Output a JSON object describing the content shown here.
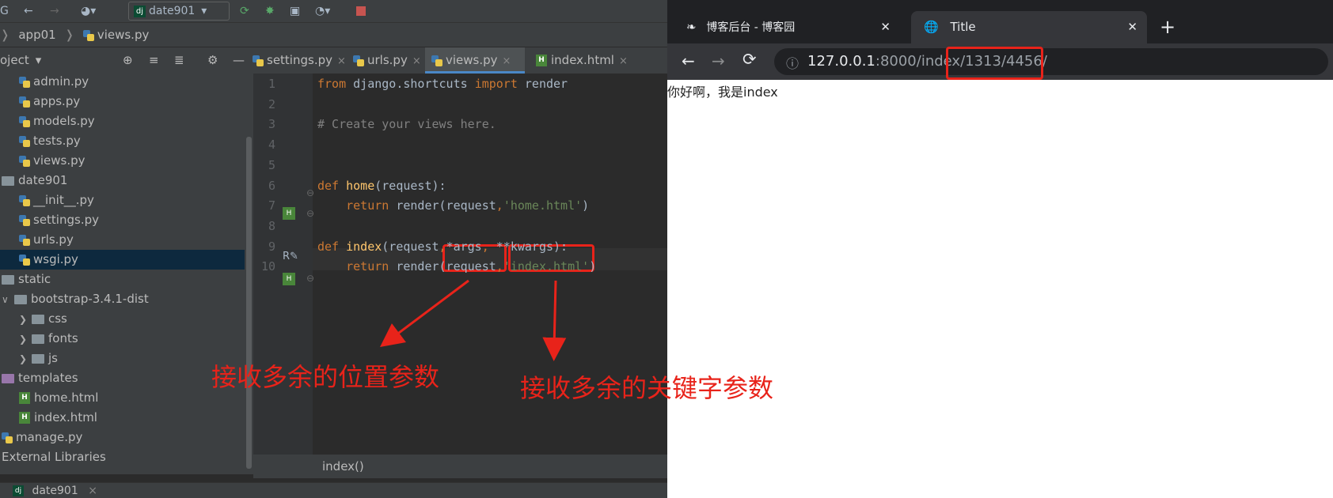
{
  "ide": {
    "toolbar": {
      "config_name": "date901"
    },
    "breadcrumb": [
      "app01",
      "views.py"
    ],
    "project_label": "oject",
    "tree": [
      {
        "label": "admin.py",
        "type": "py",
        "indent": 1
      },
      {
        "label": "apps.py",
        "type": "py",
        "indent": 1
      },
      {
        "label": "models.py",
        "type": "py",
        "indent": 1
      },
      {
        "label": "tests.py",
        "type": "py",
        "indent": 1
      },
      {
        "label": "views.py",
        "type": "py",
        "indent": 1
      },
      {
        "label": "date901",
        "type": "folder",
        "indent": 0
      },
      {
        "label": "__init__.py",
        "type": "py",
        "indent": 1
      },
      {
        "label": "settings.py",
        "type": "py",
        "indent": 1
      },
      {
        "label": "urls.py",
        "type": "py",
        "indent": 1
      },
      {
        "label": "wsgi.py",
        "type": "py",
        "indent": 1
      },
      {
        "label": "static",
        "type": "folder",
        "indent": 0
      },
      {
        "label": "bootstrap-3.4.1-dist",
        "type": "folder",
        "indent": 1
      },
      {
        "label": "css",
        "type": "folder",
        "indent": 2
      },
      {
        "label": "fonts",
        "type": "folder",
        "indent": 2
      },
      {
        "label": "js",
        "type": "folder",
        "indent": 2
      },
      {
        "label": "templates",
        "type": "folder-purple",
        "indent": 0
      },
      {
        "label": "home.html",
        "type": "html",
        "indent": 1
      },
      {
        "label": "index.html",
        "type": "html",
        "indent": 1
      },
      {
        "label": "manage.py",
        "type": "py",
        "indent": 0
      },
      {
        "label": "External Libraries",
        "type": "lib",
        "indent": 0
      }
    ],
    "tabs": [
      "settings.py",
      "urls.py",
      "views.py",
      "index.html"
    ],
    "code_lines": [
      {
        "n": "1",
        "parts": [
          [
            "kw",
            "from "
          ],
          [
            "",
            "django.shortcuts "
          ],
          [
            "kw",
            "import "
          ],
          [
            "",
            "render"
          ]
        ]
      },
      {
        "n": "2",
        "parts": []
      },
      {
        "n": "3",
        "parts": [
          [
            "cm",
            "# Create your views here."
          ]
        ]
      },
      {
        "n": "4",
        "parts": []
      },
      {
        "n": "5",
        "parts": []
      },
      {
        "n": "6",
        "parts": [
          [
            "kw",
            "def "
          ],
          [
            "fn",
            "home"
          ],
          [
            "",
            "(request):"
          ]
        ]
      },
      {
        "n": "7",
        "parts": [
          [
            "",
            "    "
          ],
          [
            "kw",
            "return "
          ],
          [
            "",
            "render(request"
          ],
          [
            "kw",
            ","
          ],
          [
            "str",
            "'home.html'"
          ],
          [
            "",
            ")"
          ]
        ]
      },
      {
        "n": "8",
        "parts": []
      },
      {
        "n": "9",
        "parts": [
          [
            "kw",
            "def "
          ],
          [
            "fn",
            "index"
          ],
          [
            "",
            "(request"
          ],
          [
            "kw",
            ","
          ],
          [
            "",
            "*args"
          ],
          [
            "kw",
            ", "
          ],
          [
            "",
            "**kwargs):"
          ]
        ]
      },
      {
        "n": "10",
        "parts": [
          [
            "",
            "    "
          ],
          [
            "kw",
            "return "
          ],
          [
            "",
            "render(request"
          ],
          [
            "kw",
            ","
          ],
          [
            "str",
            "'index.html'"
          ],
          [
            "",
            ")"
          ]
        ]
      }
    ],
    "status_func": "index()",
    "bottom_tab": "date901"
  },
  "browser": {
    "tabs": [
      {
        "title": "博客后台 - 博客园"
      },
      {
        "title": "Title"
      }
    ],
    "url_host": "127.0.0.1",
    "url_path": ":8000/index/1313/4456/",
    "page_text": "你好啊，我是index"
  },
  "annotations": {
    "args_label": "接收多余的位置参数",
    "kwargs_label": "接收多余的关键字参数"
  }
}
